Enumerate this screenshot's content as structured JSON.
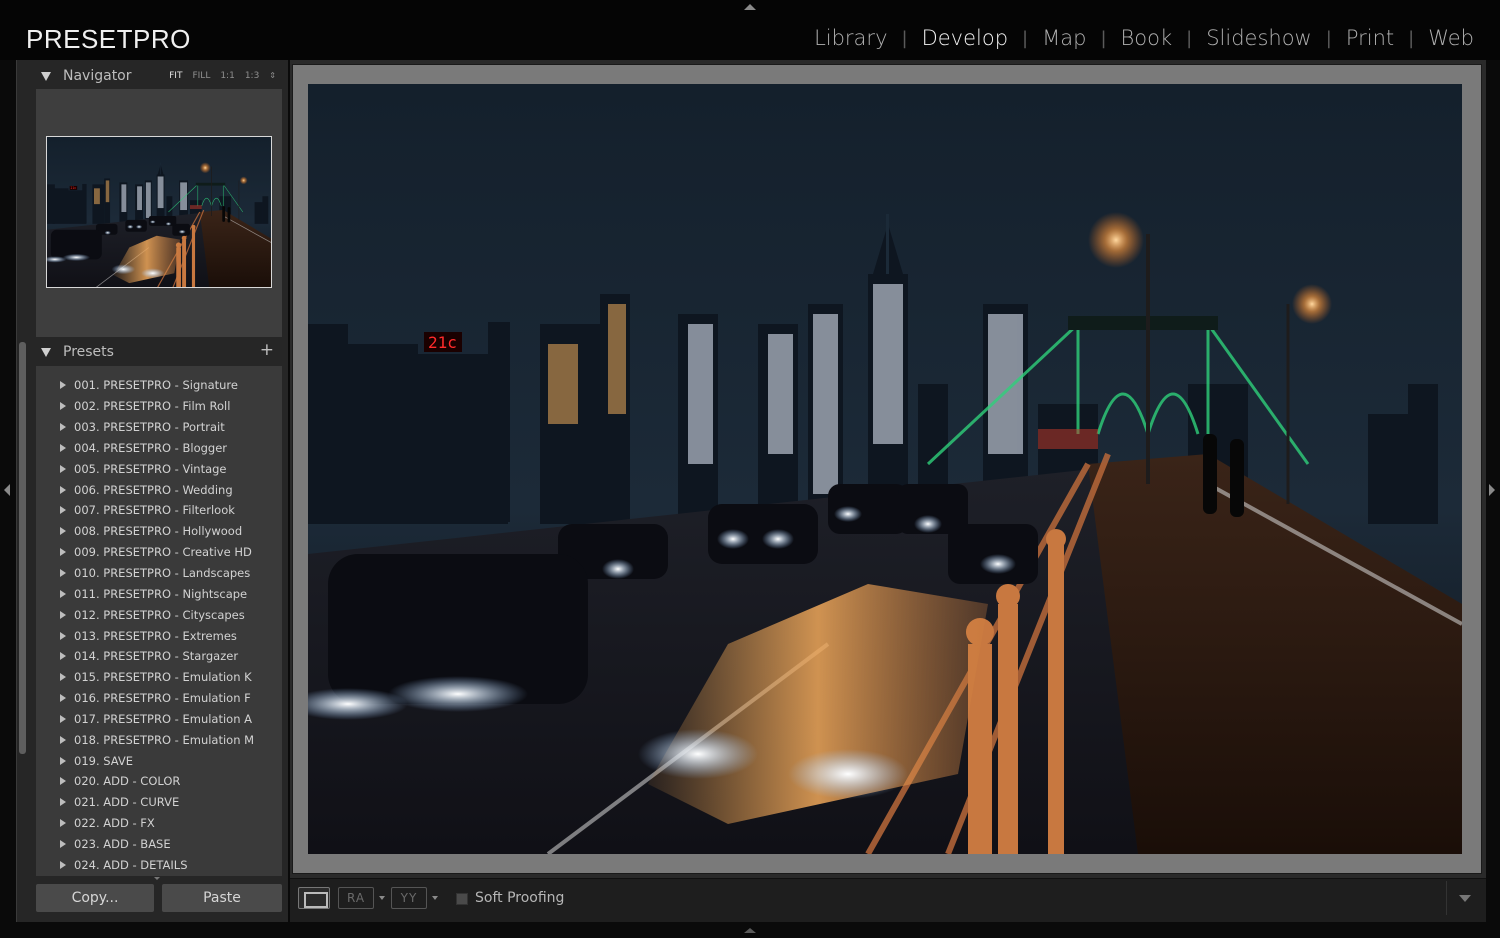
{
  "app": {
    "brand": "PRESETPRO"
  },
  "modules": [
    {
      "label": "Library",
      "active": false
    },
    {
      "label": "Develop",
      "active": true
    },
    {
      "label": "Map",
      "active": false
    },
    {
      "label": "Book",
      "active": false
    },
    {
      "label": "Slideshow",
      "active": false
    },
    {
      "label": "Print",
      "active": false
    },
    {
      "label": "Web",
      "active": false
    }
  ],
  "navigator": {
    "title": "Navigator",
    "zoom_options": [
      "FIT",
      "FILL",
      "1:1",
      "1:3"
    ],
    "selected_zoom": "FIT"
  },
  "presets": {
    "title": "Presets",
    "add_label": "+",
    "items": [
      "001. PRESETPRO - Signature",
      "002. PRESETPRO - Film Roll",
      "003. PRESETPRO - Portrait",
      "004. PRESETPRO - Blogger",
      "005. PRESETPRO - Vintage",
      "006. PRESETPRO - Wedding",
      "007. PRESETPRO - Filterlook",
      "008. PRESETPRO - Hollywood",
      "009. PRESETPRO - Creative HD",
      "010. PRESETPRO - Landscapes",
      "011. PRESETPRO - Nightscape",
      "012. PRESETPRO - Cityscapes",
      "013. PRESETPRO - Extremes",
      "014. PRESETPRO - Stargazer",
      "015. PRESETPRO - Emulation K",
      "016. PRESETPRO - Emulation F",
      "017. PRESETPRO - Emulation A",
      "018. PRESETPRO - Emulation M",
      "019. SAVE",
      "020. ADD - COLOR",
      "021. ADD - CURVE",
      "022. ADD - FX",
      "023. ADD - BASE",
      "024. ADD - DETAILS"
    ]
  },
  "buttons": {
    "copy": "Copy...",
    "paste": "Paste"
  },
  "toolbar": {
    "soft_proofing_label": "Soft Proofing",
    "soft_proofing_checked": false,
    "compare_ra": "RA",
    "compare_yy": "YY"
  },
  "photo": {
    "billboard": "21c"
  },
  "colors": {
    "accent_text": "#f2f2f2",
    "panel_bg": "#262626",
    "panel_box": "#3a3a3a",
    "canvas_bg": "#7a7a7a"
  }
}
